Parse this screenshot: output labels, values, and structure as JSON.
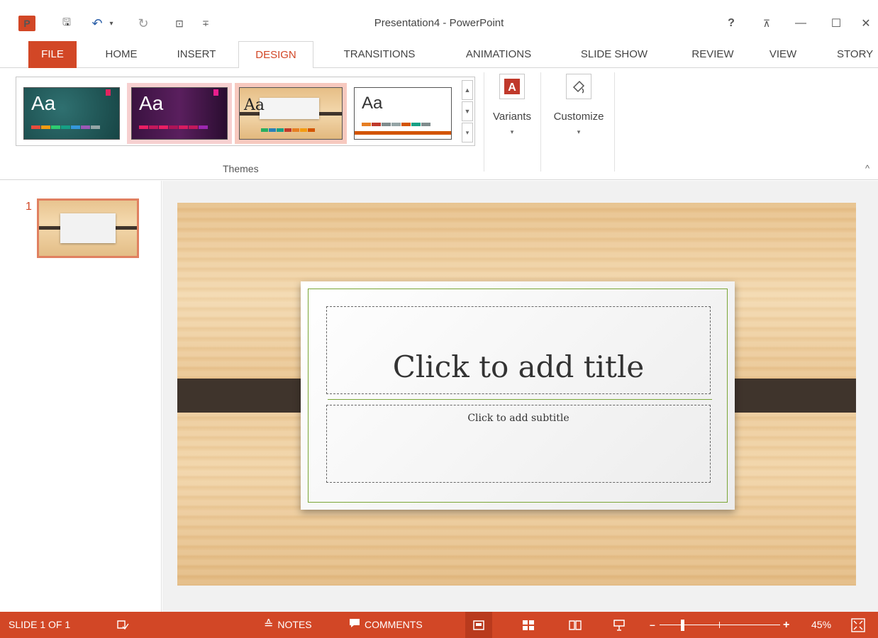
{
  "window": {
    "title": "Presentation4 - PowerPoint",
    "logo_text": "P",
    "help": "?",
    "ribbon_display": "⊼",
    "minimize": "—",
    "maximize": "☐",
    "close": "✕"
  },
  "qat": {
    "save": "🖫",
    "undo": "↶",
    "undo_arrow": "▾",
    "redo": "↻",
    "presenter": "⊡",
    "customize": "∓"
  },
  "tabs": [
    "FILE",
    "HOME",
    "INSERT",
    "DESIGN",
    "TRANSITIONS",
    "ANIMATIONS",
    "SLIDE SHOW",
    "REVIEW",
    "VIEW",
    "STORY"
  ],
  "active_tab": "DESIGN",
  "ribbon": {
    "themes": [
      {
        "label": "Aa",
        "bg": "#1f5a5a",
        "fg": "#ffffff",
        "swatches": [
          "#e74c3c",
          "#f39c12",
          "#2ecc71",
          "#16a085",
          "#3498db",
          "#9b59b6",
          "#95a5a6"
        ]
      },
      {
        "label": "Aa",
        "bg": "#4a1a4a",
        "fg": "#ffffff",
        "swatches": [
          "#e91e63",
          "#c2185b",
          "#e91e63",
          "#ad1457",
          "#d81b60",
          "#c2185b",
          "#9c27b0"
        ]
      },
      {
        "label": "Aa",
        "bg": "#e8c48f",
        "fg": "#222222",
        "swatches": [
          "#27ae60",
          "#2980b9",
          "#16a085",
          "#c0392b",
          "#e67e22",
          "#f39c12",
          "#d35400"
        ]
      },
      {
        "label": "Aa",
        "bg": "#ffffff",
        "fg": "#333333",
        "swatches": [
          "#e67e22",
          "#c0392b",
          "#7f8c8d",
          "#95a5a6",
          "#d35400",
          "#16a085",
          "#7f8c8d"
        ]
      }
    ],
    "themes_group_label": "Themes",
    "variants_label": "Variants",
    "customize_label": "Customize",
    "scroll_up": "▲",
    "scroll_down": "▼",
    "scroll_more": "▾",
    "collapse": "^"
  },
  "slides_panel": {
    "slide_number": "1"
  },
  "slide": {
    "title_placeholder": "Click to add title",
    "subtitle_placeholder": "Click to add subtitle"
  },
  "statusbar": {
    "slide_info": "SLIDE 1 OF 1",
    "notes_label": "NOTES",
    "comments_label": "COMMENTS",
    "zoom_out": "–",
    "zoom_in": "+",
    "zoom_percent": "45%"
  },
  "colors": {
    "accent": "#d24726"
  }
}
